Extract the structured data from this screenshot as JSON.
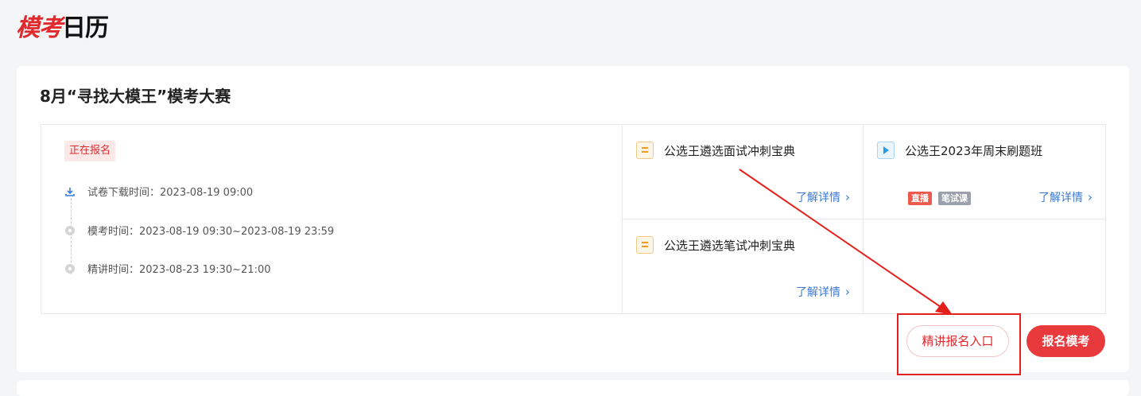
{
  "logo": {
    "part1": "模考",
    "part2": "日历"
  },
  "event": {
    "title": "8月“寻找大模王”模考大赛",
    "status": "正在报名",
    "timeline": [
      {
        "icon": "download-icon",
        "text": "试卷下载时间：2023-08-19 09:00"
      },
      {
        "icon": "dot-icon",
        "text": "模考时间：2023-08-19 09:30~2023-08-19 23:59"
      },
      {
        "icon": "dot-icon",
        "text": "精讲时间：2023-08-23 19:30~21:00"
      }
    ]
  },
  "courses": [
    {
      "icon": "document-icon",
      "title": "公选王遴选面试冲刺宝典",
      "more": "了解详情"
    },
    {
      "icon": "video-play-icon",
      "title": "公选王2023年周末刷题班",
      "more": "了解详情",
      "tags": [
        "直播",
        "笔试课"
      ]
    },
    {
      "icon": "document-icon",
      "title": "公选王遴选笔试冲刺宝典",
      "more": "了解详情"
    }
  ],
  "buttons": {
    "lecture_signup": "精讲报名入口",
    "exam_signup": "报名模考"
  },
  "colors": {
    "accent": "#e8393d",
    "link": "#3a7ad8",
    "live_tag": "#ef5a4f",
    "course_tag": "#9aa1ab"
  }
}
